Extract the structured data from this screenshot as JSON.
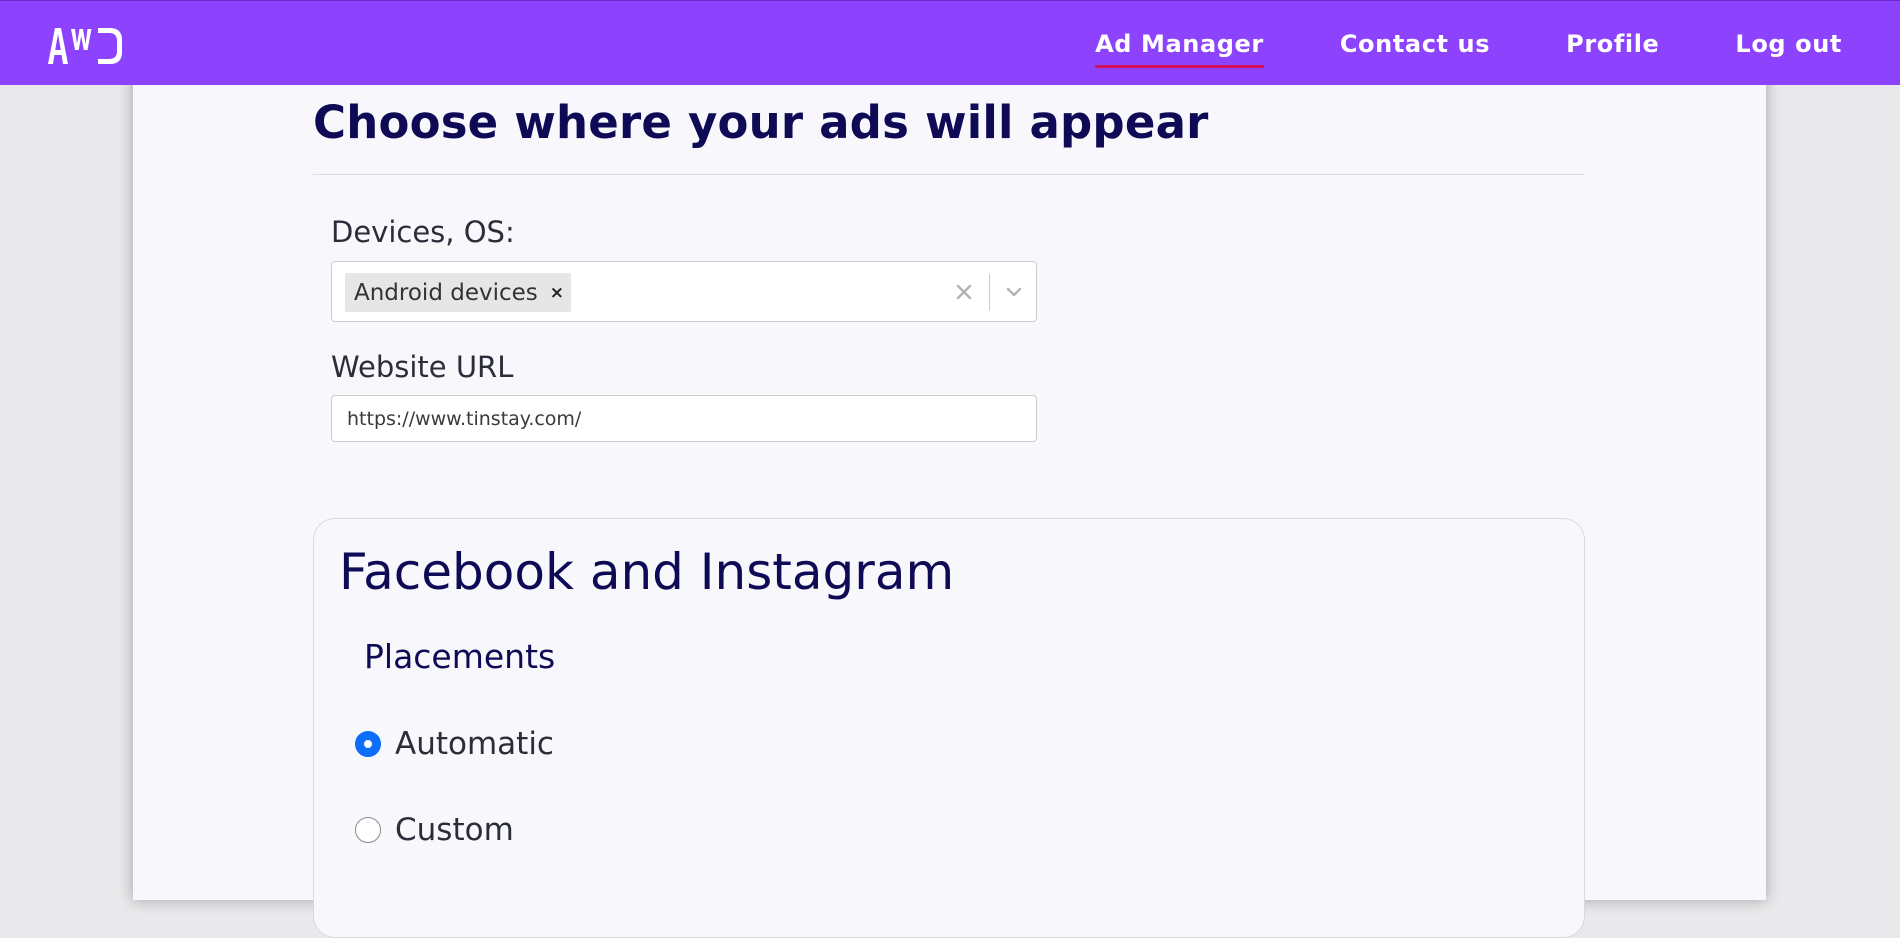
{
  "brand": {
    "logo_text": "AWD",
    "nav_color": "#8d42fd",
    "active_underline_color": "#d1135a",
    "heading_color": "#0e0a55",
    "radio_accent": "#0d6efd"
  },
  "nav": {
    "links": [
      {
        "label": "Ad Manager",
        "active": true
      },
      {
        "label": "Contact us",
        "active": false
      },
      {
        "label": "Profile",
        "active": false
      },
      {
        "label": "Log out",
        "active": false
      }
    ]
  },
  "page": {
    "title": "Choose where your ads will appear"
  },
  "form": {
    "devices": {
      "label": "Devices, OS:",
      "selected": [
        "Android devices"
      ],
      "remove_icon": "×",
      "clear_icon": "close-icon",
      "dropdown_icon": "chevron-down-icon"
    },
    "website": {
      "label": "Website URL",
      "value": "https://www.tinstay.com/"
    }
  },
  "facebook": {
    "title": "Facebook and Instagram",
    "placements_title": "Placements",
    "options": [
      {
        "label": "Automatic",
        "checked": true
      },
      {
        "label": "Custom",
        "checked": false
      }
    ]
  }
}
